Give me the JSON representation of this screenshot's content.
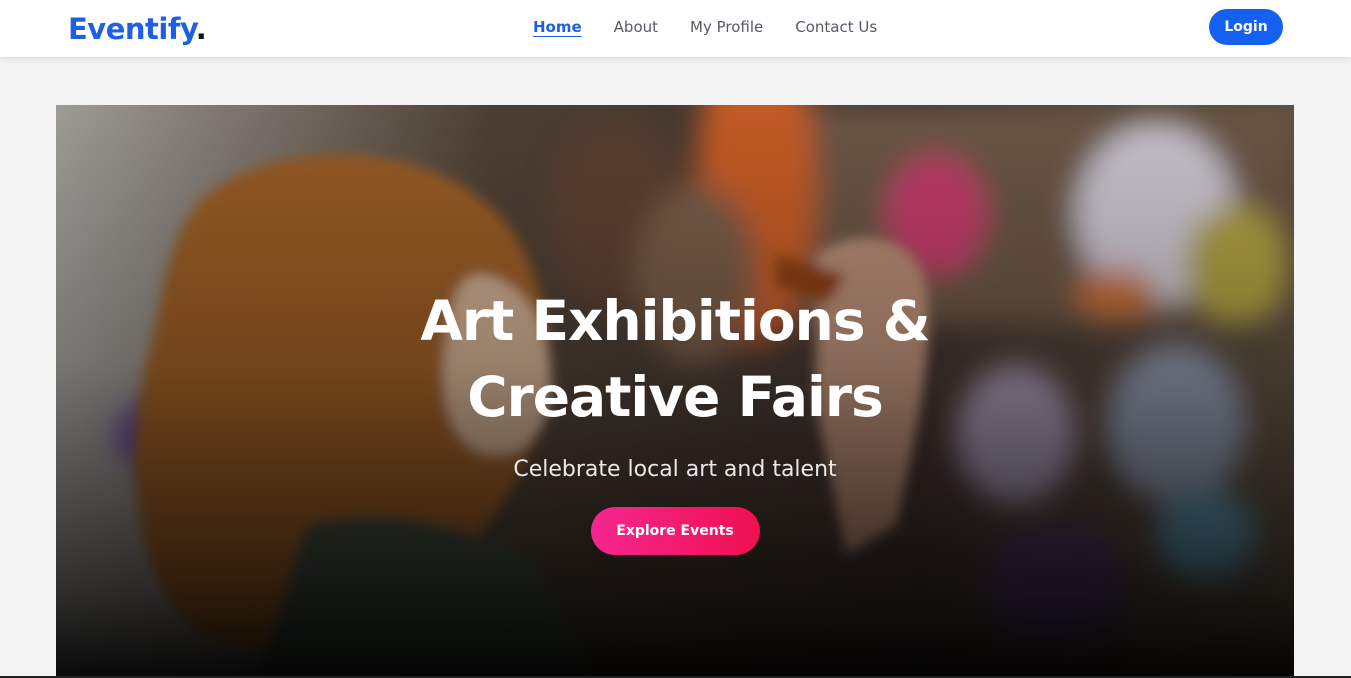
{
  "brand": {
    "name": "Eventify",
    "dot": ".",
    "color": "#1f5fe6"
  },
  "nav": {
    "links": [
      {
        "label": "Home",
        "active": true
      },
      {
        "label": "About",
        "active": false
      },
      {
        "label": "My Profile",
        "active": false
      },
      {
        "label": "Contact Us",
        "active": false
      }
    ],
    "login_label": "Login"
  },
  "hero": {
    "title": "Art Exhibitions & Creative Fairs",
    "subtitle": "Celebrate local art and talent",
    "cta_label": "Explore Events",
    "cta_colors": [
      "#f4268f",
      "#f0104f"
    ]
  },
  "colors": {
    "accent": "#1460f0",
    "page_bg": "#f3f3f3"
  }
}
